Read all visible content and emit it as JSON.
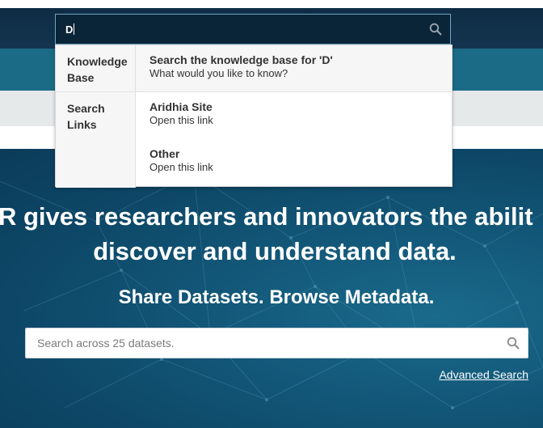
{
  "kb_search": {
    "value": "D"
  },
  "dropdown": {
    "knowledge_base": {
      "category": "Knowledge Base",
      "item": {
        "title": "Search the knowledge base for 'D'",
        "subtitle": "What would you like to know?"
      }
    },
    "search_links": {
      "category": "Search Links",
      "items": [
        {
          "title": "Aridhia Site",
          "subtitle": "Open this link"
        },
        {
          "title": "Other",
          "subtitle": "Open this link"
        }
      ]
    }
  },
  "hero": {
    "headline_line1": "R gives researchers and innovators the abilit",
    "headline_line2": "discover and understand data.",
    "subheadline": "Share Datasets. Browse Metadata.",
    "dataset_search_placeholder": "Search across 25 datasets.",
    "advanced_search_link": "Advanced Search"
  },
  "colors": {
    "top_bar": "#0e2c44",
    "teal_bar": "#1b6b86",
    "grey_bar": "#e6e9ea",
    "hero_bg": "#135879"
  },
  "icons": {
    "kb_search": "search-icon",
    "dataset_search": "search-icon"
  }
}
